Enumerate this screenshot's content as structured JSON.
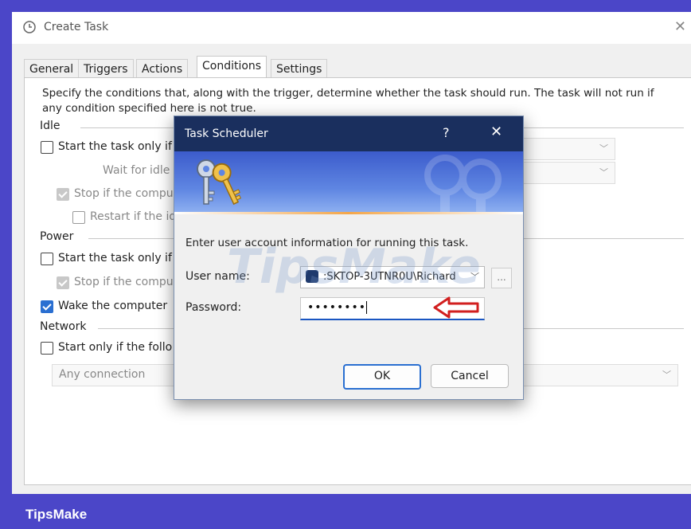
{
  "window": {
    "title": "Create Task"
  },
  "tabs": [
    {
      "label": "General"
    },
    {
      "label": "Triggers"
    },
    {
      "label": "Actions"
    },
    {
      "label": "Conditions"
    },
    {
      "label": "Settings"
    }
  ],
  "active_tab": "Conditions",
  "conditions": {
    "description": "Specify the conditions that, along with the trigger, determine whether the task should run.  The task will not run  if any condition specified here is not true.",
    "idle": {
      "section": "Idle",
      "start_only_if": "Start the task only if",
      "wait_for_idle": "Wait for idle",
      "stop_if": "Stop if the compu",
      "restart_if": "Restart if the id"
    },
    "power": {
      "section": "Power",
      "start_only_if": "Start the task only if",
      "stop_if": "Stop if the compu",
      "wake": "Wake the computer"
    },
    "network": {
      "section": "Network",
      "start_only_if": "Start only if the follo",
      "connection": "Any connection"
    }
  },
  "dialog": {
    "title": "Task Scheduler",
    "help": "?",
    "close": "✕",
    "info": "Enter user account information for running this task.",
    "user_label": "User name:",
    "user_value": ":SKTOP-3UTNR0U\\Richard",
    "password_label": "Password:",
    "password_value": "••••••••",
    "browse": "...",
    "ok": "OK",
    "cancel": "Cancel"
  },
  "watermark": "TipsMake",
  "brand": "TipsMake",
  "colors": {
    "accent": "#2a6fd1",
    "dialog_title": "#1a2f5e",
    "border_bg": "#4b46c8"
  }
}
